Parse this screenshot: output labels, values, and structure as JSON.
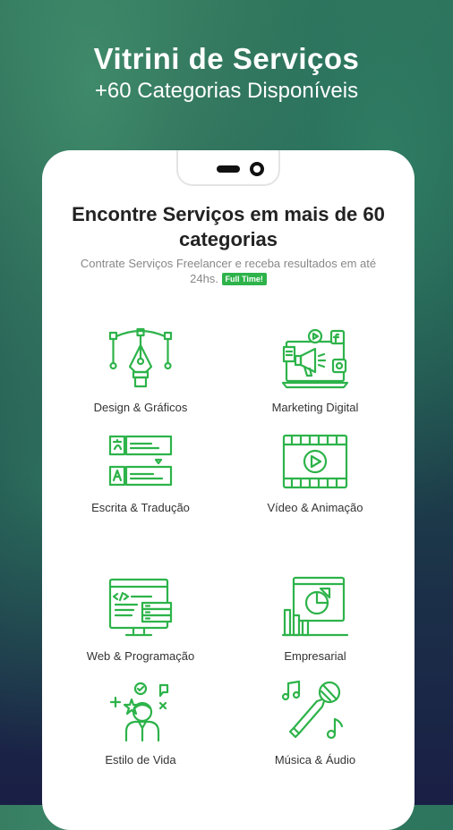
{
  "hero": {
    "title": "Vitrini de Serviços",
    "subtitle": "+60 Categorias Disponíveis"
  },
  "screen": {
    "heading": "Encontre Serviços em mais de 60 categorias",
    "description": "Contrate Serviços Freelancer e receba resultados em até 24hs.",
    "badge": "Full Time!",
    "accent_color": "#2db34a"
  },
  "categories": [
    {
      "label": "Design & Gráficos",
      "icon": "pen-tool-icon"
    },
    {
      "label": "Marketing Digital",
      "icon": "megaphone-icon"
    },
    {
      "label": "Escrita & Tradução",
      "icon": "translation-icon"
    },
    {
      "label": "Vídeo & Animação",
      "icon": "video-film-icon"
    },
    {
      "label": "Web & Programação",
      "icon": "code-monitor-icon"
    },
    {
      "label": "Empresarial",
      "icon": "business-chart-icon"
    },
    {
      "label": "Estilo de Vida",
      "icon": "lifestyle-person-icon"
    },
    {
      "label": "Música & Áudio",
      "icon": "microphone-music-icon"
    }
  ]
}
